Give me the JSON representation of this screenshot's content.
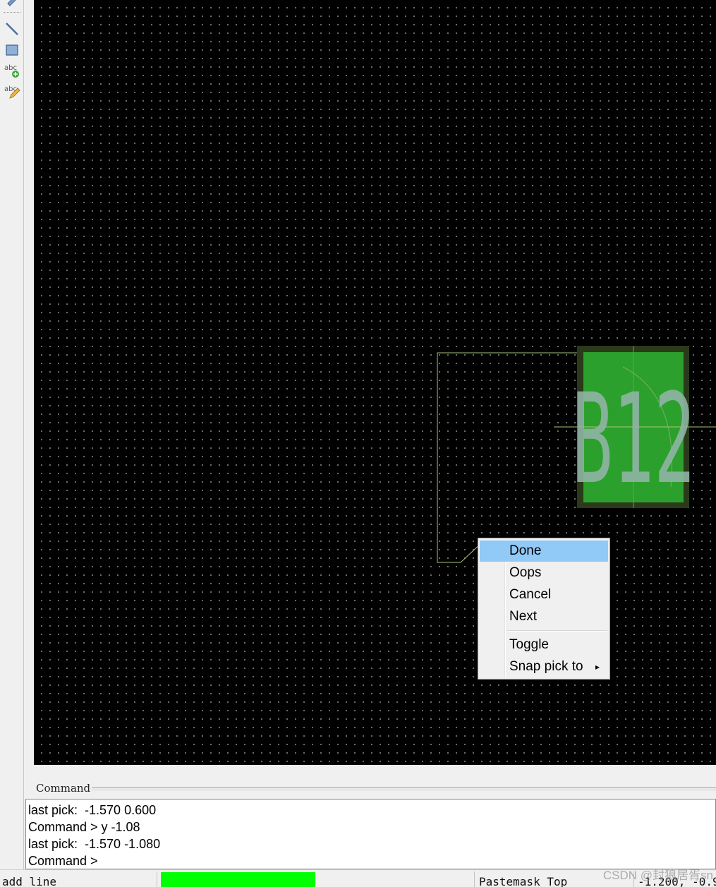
{
  "toolbar": {
    "buttons": [
      "edit-icon",
      "add-line-icon",
      "add-rectangle-icon",
      "add-text-icon",
      "edit-text-icon"
    ],
    "add_text_glyph": "abc",
    "edit_text_glyph": "abc"
  },
  "canvas": {
    "background_color": "#000000",
    "grid_color": "#8a8a8a",
    "pad_color": "#2ca02c",
    "pad_border_color": "#2a3a1a",
    "pad_label": "B12",
    "outline_color": "#a9c67a"
  },
  "context_menu": {
    "items": [
      {
        "label": "Done",
        "highlighted": true
      },
      {
        "label": "Oops"
      },
      {
        "label": "Cancel"
      },
      {
        "label": "Next"
      },
      {
        "label": "Toggle"
      },
      {
        "label": "Snap pick to",
        "has_submenu": true
      }
    ],
    "submenu_arrow": "▸"
  },
  "command": {
    "title": "Command",
    "log": [
      "last pick:  -1.570 0.600",
      "Command > y -1.08",
      "last pick:  -1.570 -1.080",
      "Command >"
    ]
  },
  "statusbar": {
    "mode": "add line",
    "progress_color": "#00ff00",
    "layer": "Pastemask Top",
    "coordinates": "-1.200, -0.9"
  },
  "watermark": "CSDN @封狼居胥sn"
}
